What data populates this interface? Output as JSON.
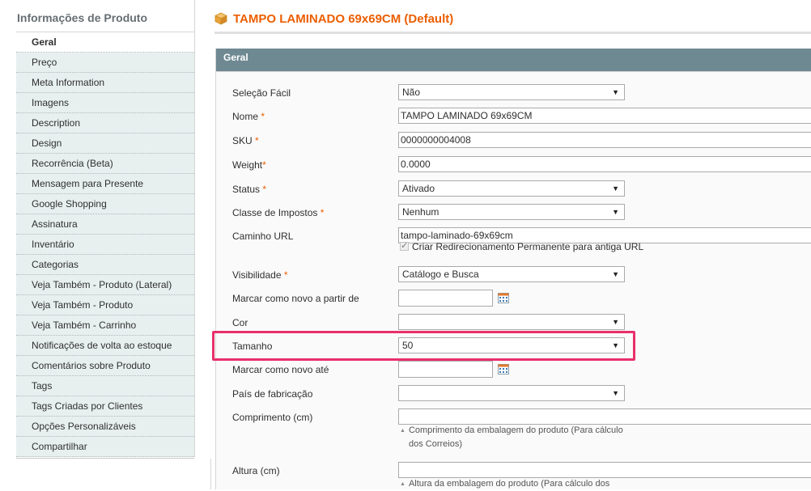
{
  "sidebar": {
    "title": "Informações de Produto",
    "items": [
      {
        "label": "Geral",
        "active": true
      },
      {
        "label": "Preço"
      },
      {
        "label": "Meta Information"
      },
      {
        "label": "Imagens"
      },
      {
        "label": "Description"
      },
      {
        "label": "Design"
      },
      {
        "label": "Recorrência (Beta)"
      },
      {
        "label": "Mensagem para Presente"
      },
      {
        "label": "Google Shopping"
      },
      {
        "label": "Assinatura"
      },
      {
        "label": "Inventário"
      },
      {
        "label": "Categorias"
      },
      {
        "label": "Veja Também - Produto (Lateral)"
      },
      {
        "label": "Veja Também - Produto"
      },
      {
        "label": "Veja Também - Carrinho"
      },
      {
        "label": "Notificações de volta ao estoque"
      },
      {
        "label": "Comentários sobre Produto"
      },
      {
        "label": "Tags"
      },
      {
        "label": "Tags Criadas por Clientes"
      },
      {
        "label": "Opções Personalizáveis"
      },
      {
        "label": "Compartilhar"
      }
    ]
  },
  "header": {
    "title": "TAMPO LAMINADO 69x69CM (Default)",
    "icon": "box-icon"
  },
  "fieldset": {
    "title": "Geral",
    "fields": {
      "selecao_facil": {
        "label": "Seleção Fácil",
        "value": "Não"
      },
      "nome": {
        "label": "Nome",
        "required": "*",
        "value": "TAMPO LAMINADO 69x69CM"
      },
      "sku": {
        "label": "SKU",
        "required": "*",
        "value": "0000000004008"
      },
      "weight": {
        "label": "Weight",
        "required": "*",
        "value": "0.0000"
      },
      "status": {
        "label": "Status",
        "required": "*",
        "value": "Ativado"
      },
      "classe_impostos": {
        "label": "Classe de Impostos",
        "required": "*",
        "value": "Nenhum"
      },
      "caminho_url": {
        "label": "Caminho URL",
        "value": "tampo-laminado-69x69cm",
        "checkbox_label": "Criar Redirecionamento Permanente para antiga URL"
      },
      "visibilidade": {
        "label": "Visibilidade",
        "required": "*",
        "value": "Catálogo e Busca"
      },
      "novo_de": {
        "label": "Marcar como novo a partir de",
        "value": ""
      },
      "cor": {
        "label": "Cor",
        "value": ""
      },
      "tamanho": {
        "label": "Tamanho",
        "value": "50"
      },
      "novo_ate": {
        "label": "Marcar como novo até",
        "value": ""
      },
      "pais": {
        "label": "País de fabricação",
        "value": ""
      },
      "comprimento": {
        "label": "Comprimento (cm)",
        "value": "",
        "note_line1": "Comprimento da embalagem do produto (Para cálculo",
        "note_line2": "dos Correios)"
      },
      "altura": {
        "label": "Altura (cm)",
        "value": "",
        "note_line1": "Altura da embalagem do produto (Para cálculo dos"
      }
    }
  },
  "colors": {
    "title_orange": "#eb5e00",
    "section_header": "#6f8992",
    "highlight": "#e8306b",
    "sidebar_bg": "#e7efef"
  }
}
